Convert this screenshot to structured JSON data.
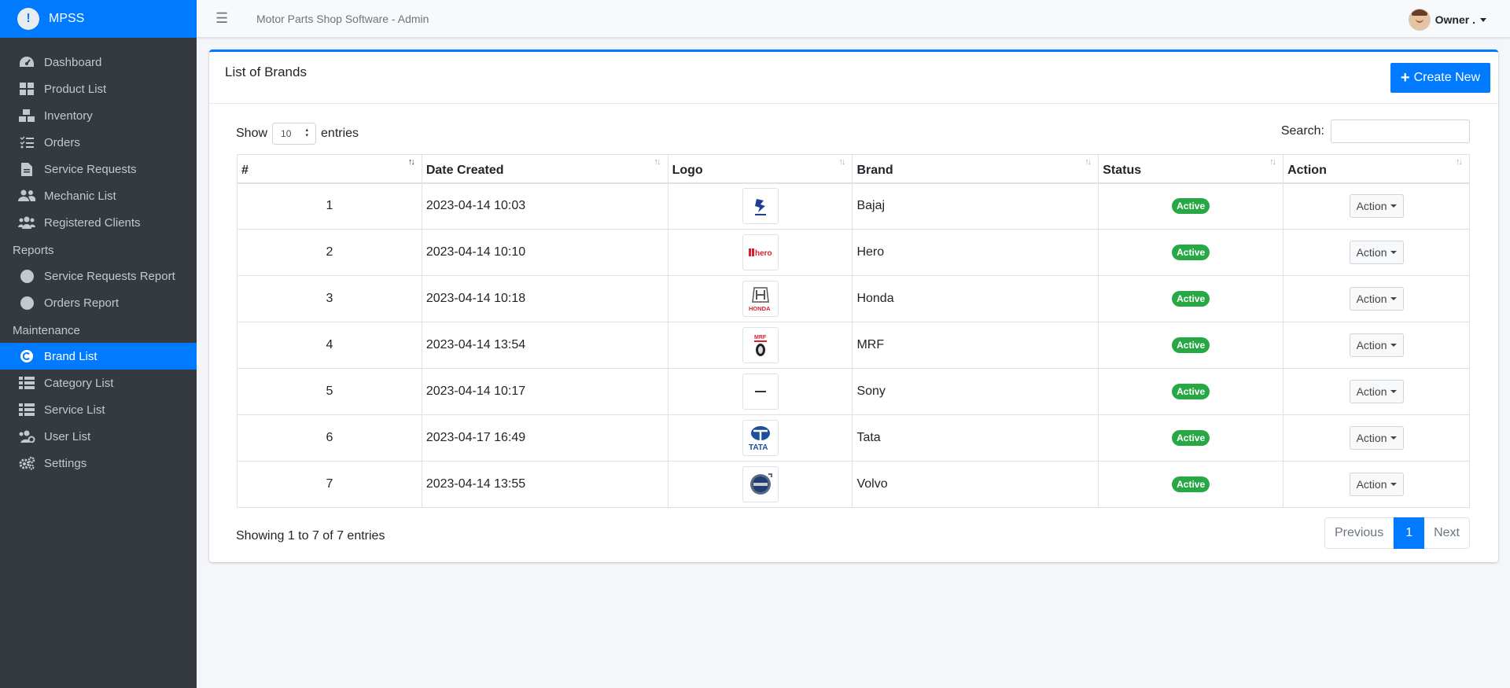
{
  "sidebar": {
    "brand": "MPSS",
    "items": [
      {
        "label": "Dashboard",
        "icon": "tachometer-icon"
      },
      {
        "label": "Product List",
        "icon": "th-large-icon"
      },
      {
        "label": "Inventory",
        "icon": "boxes-icon"
      },
      {
        "label": "Orders",
        "icon": "list-check-icon"
      },
      {
        "label": "Service Requests",
        "icon": "file-alt-icon"
      },
      {
        "label": "Mechanic List",
        "icon": "users-icon"
      },
      {
        "label": "Registered Clients",
        "icon": "user-friends-icon"
      }
    ],
    "reports_header": "Reports",
    "reports": [
      {
        "label": "Service Requests Report",
        "icon": "circle-icon"
      },
      {
        "label": "Orders Report",
        "icon": "circle-icon"
      }
    ],
    "maintenance_header": "Maintenance",
    "maintenance": [
      {
        "label": "Brand List",
        "icon": "copyright-icon",
        "active": true
      },
      {
        "label": "Category List",
        "icon": "th-list-icon"
      },
      {
        "label": "Service List",
        "icon": "th-list-icon"
      },
      {
        "label": "User List",
        "icon": "users-cog-icon"
      },
      {
        "label": "Settings",
        "icon": "cogs-icon"
      }
    ]
  },
  "topbar": {
    "title": "Motor Parts Shop Software - Admin",
    "user": "Owner ."
  },
  "card": {
    "title": "List of Brands",
    "create_button": "Create New"
  },
  "table_controls": {
    "show": "Show",
    "length": "10",
    "entries": "entries",
    "search_label": "Search:"
  },
  "table": {
    "headers": [
      "#",
      "Date Created",
      "Logo",
      "Brand",
      "Status",
      "Action"
    ],
    "rows": [
      {
        "num": "1",
        "date": "2023-04-14 10:03",
        "brand": "Bajaj",
        "status": "Active",
        "action": "Action",
        "logo": "bajaj-logo"
      },
      {
        "num": "2",
        "date": "2023-04-14 10:10",
        "brand": "Hero",
        "status": "Active",
        "action": "Action",
        "logo": "hero-logo"
      },
      {
        "num": "3",
        "date": "2023-04-14 10:18",
        "brand": "Honda",
        "status": "Active",
        "action": "Action",
        "logo": "honda-logo"
      },
      {
        "num": "4",
        "date": "2023-04-14 13:54",
        "brand": "MRF",
        "status": "Active",
        "action": "Action",
        "logo": "mrf-logo"
      },
      {
        "num": "5",
        "date": "2023-04-14 10:17",
        "brand": "Sony",
        "status": "Active",
        "action": "Action",
        "logo": "sony-logo"
      },
      {
        "num": "6",
        "date": "2023-04-17 16:49",
        "brand": "Tata",
        "status": "Active",
        "action": "Action",
        "logo": "tata-logo"
      },
      {
        "num": "7",
        "date": "2023-04-14 13:55",
        "brand": "Volvo",
        "status": "Active",
        "action": "Action",
        "logo": "volvo-logo"
      }
    ]
  },
  "footer": {
    "info": "Showing 1 to 7 of 7 entries",
    "previous": "Previous",
    "page": "1",
    "next": "Next"
  },
  "colors": {
    "primary": "#007bff",
    "sidebar": "#343a40",
    "success": "#28a745"
  }
}
